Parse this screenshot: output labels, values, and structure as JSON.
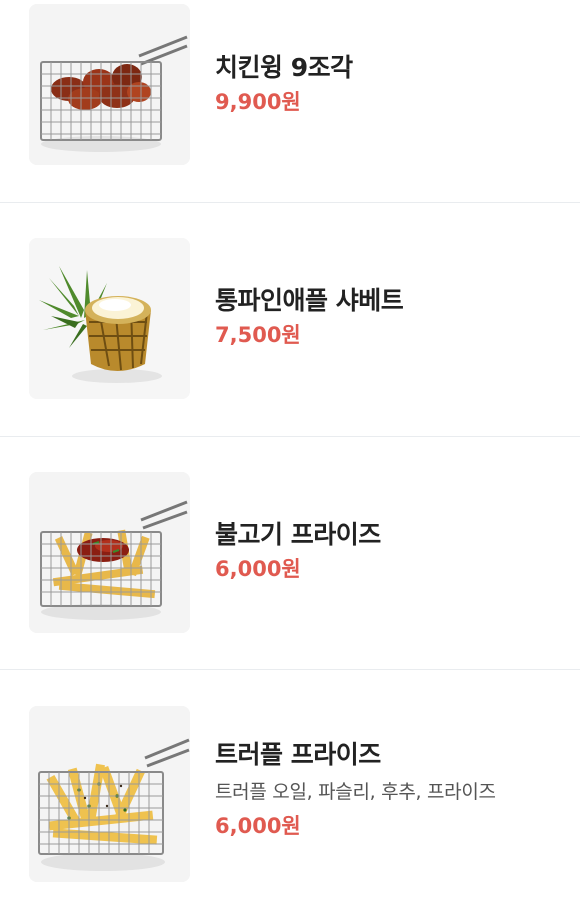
{
  "colors": {
    "price": "#e05a50",
    "name": "#222222",
    "description": "#555555",
    "divider": "#e9ecef"
  },
  "menu": {
    "items": [
      {
        "name": "치킨윙 9조각",
        "description": "",
        "price": "9,900원",
        "image": "chicken-wings-basket-photo"
      },
      {
        "name": "통파인애플 샤베트",
        "description": "",
        "price": "7,500원",
        "image": "pineapple-sherbet-photo"
      },
      {
        "name": "불고기 프라이즈",
        "description": "",
        "price": "6,000원",
        "image": "bulgogi-fries-basket-photo"
      },
      {
        "name": "트러플 프라이즈",
        "description": "트러플 오일, 파슬리, 후추, 프라이즈",
        "price": "6,000원",
        "image": "truffle-fries-basket-photo"
      }
    ]
  }
}
